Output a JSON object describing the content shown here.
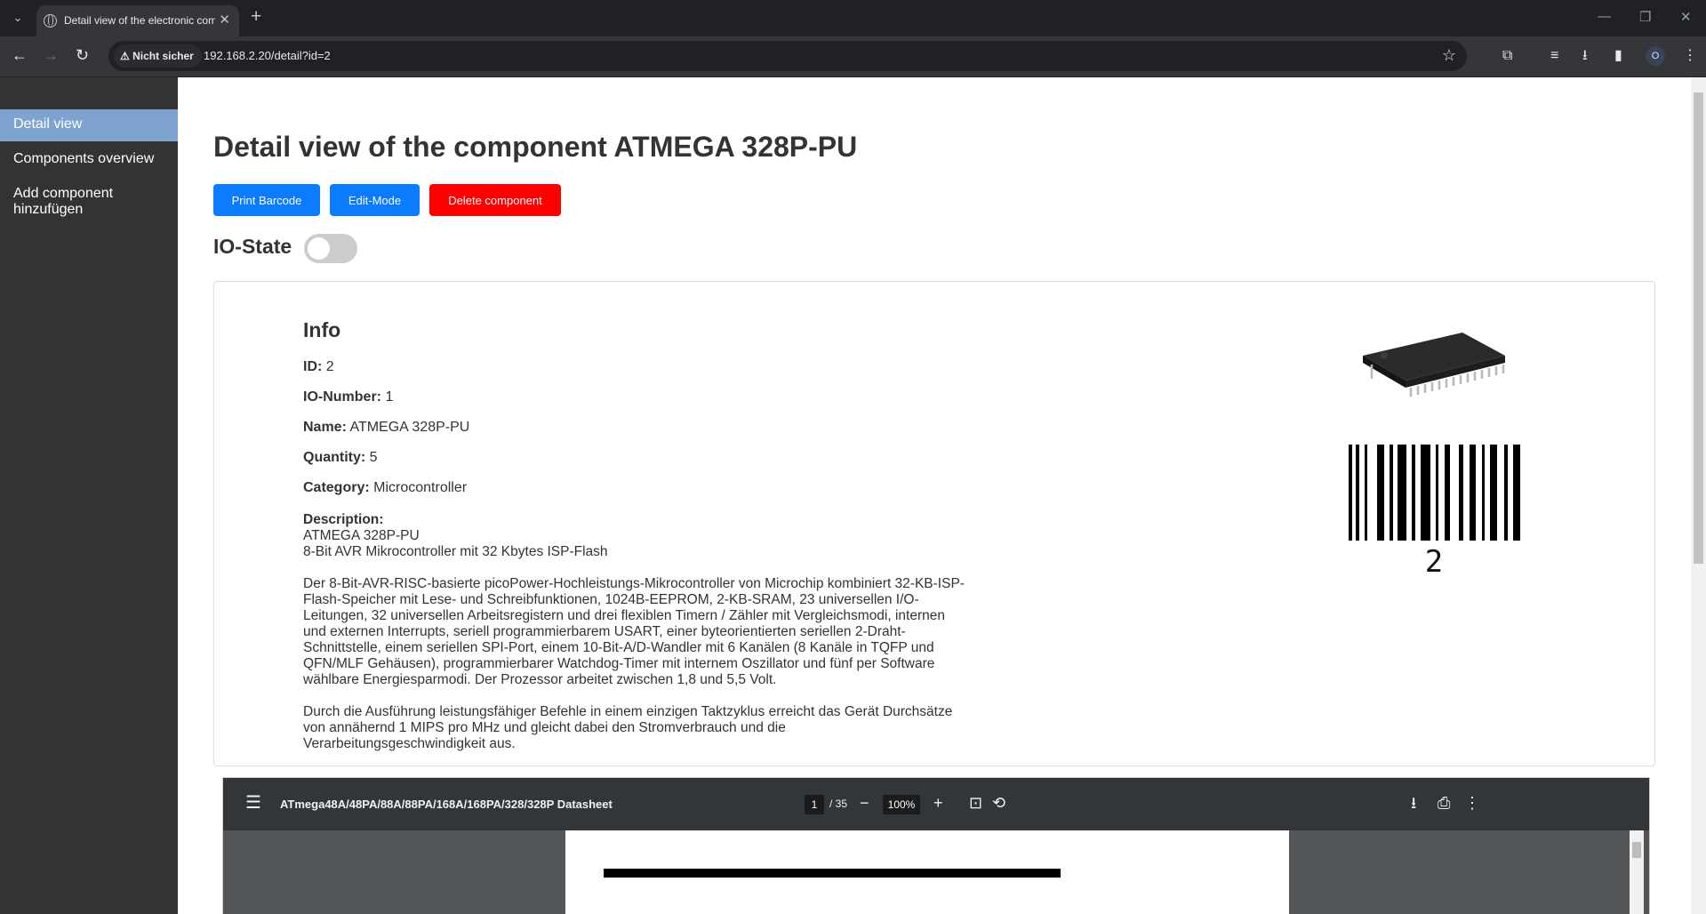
{
  "browser": {
    "tab_title": "Detail view of the electronic component",
    "new_tab_label": "+",
    "security_label": "Nicht sicher",
    "url": "192.168.2.20/detail?id=2",
    "profile_initial": "O"
  },
  "sidebar": {
    "items": [
      {
        "label": "Detail view",
        "active": true
      },
      {
        "label": "Components overview",
        "active": false
      },
      {
        "label": "Add component hinzufügen",
        "active": false
      }
    ]
  },
  "main": {
    "title": "Detail view of the component ATMEGA 328P-PU",
    "buttons": {
      "print": "Print Barcode",
      "edit": "Edit-Mode",
      "delete": "Delete component"
    },
    "io_state": {
      "label": "IO-State",
      "on": false
    }
  },
  "info": {
    "heading": "Info",
    "fields": {
      "id": {
        "label": "ID:",
        "value": "2"
      },
      "io_number": {
        "label": "IO-Number:",
        "value": "1"
      },
      "name": {
        "label": "Name:",
        "value": "ATMEGA 328P-PU"
      },
      "quantity": {
        "label": "Quantity:",
        "value": "5"
      },
      "category": {
        "label": "Category:",
        "value": "Microcontroller"
      }
    },
    "description_label": "Description:",
    "description_lines": "ATMEGA 328P-PU\n8-Bit AVR Mikrocontroller mit 32 Kbytes ISP-Flash",
    "description_p1": "Der 8-Bit-AVR-RISC-basierte picoPower-Hochleistungs-Mikrocontroller von Microchip kombiniert 32-KB-ISP-Flash-Speicher mit Lese- und Schreibfunktionen, 1024B-EEPROM, 2-KB-SRAM, 23 universellen I/O-Leitungen, 32 universellen Arbeitsregistern und drei flexiblen Timern / Zähler mit Vergleichsmodi, internen und externen Interrupts, seriell programmierbarem USART, einer byteorientierten seriellen 2-Draht-Schnittstelle, einem seriellen SPI-Port, einem 10-Bit-A/D-Wandler mit 6 Kanälen (8 Kanäle in TQFP und QFN/MLF Gehäusen), programmierbarer Watchdog-Timer mit internem Oszillator und fünf per Software wählbare Energiesparmodi. Der Prozessor arbeitet zwischen 1,8 und 5,5 Volt.",
    "description_p2": "Durch die Ausführung leistungsfähiger Befehle in einem einzigen Taktzyklus erreicht das Gerät Durchsätze von annähernd 1 MIPS pro MHz und gleicht dabei den Stromverbrauch und die Verarbeitungsgeschwindigkeit aus.",
    "barcode_number": "2"
  },
  "pdf": {
    "title": "ATmega48A/48PA/88A/88PA/168A/168PA/328/328P Datasheet",
    "page": "1",
    "total": "/ 35",
    "zoom": "100%"
  },
  "colors": {
    "sidebar_bg": "#333333",
    "sidebar_active": "#7fa3d1",
    "button_blue": "#0b7bff",
    "button_red": "#ff0000"
  }
}
